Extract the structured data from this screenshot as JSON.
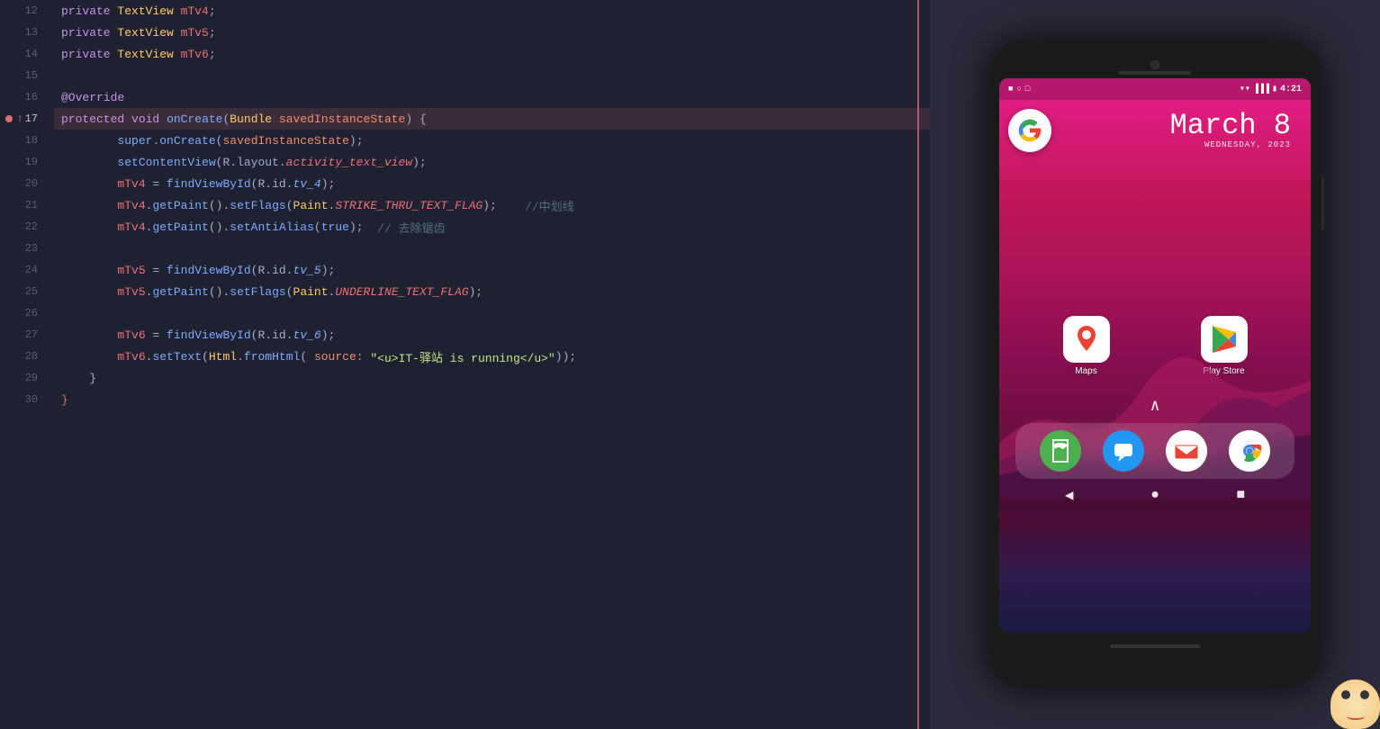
{
  "editor": {
    "lines": [
      {
        "num": 12,
        "content": "    private TextView mTv4;",
        "active": false,
        "breakpoint": false,
        "debugArrow": false
      },
      {
        "num": 13,
        "content": "    private TextView mTv5;",
        "active": false,
        "breakpoint": false,
        "debugArrow": false
      },
      {
        "num": 14,
        "content": "    private TextView mTv6;",
        "active": false,
        "breakpoint": false,
        "debugArrow": false
      },
      {
        "num": 15,
        "content": "",
        "active": false,
        "breakpoint": false,
        "debugArrow": false
      },
      {
        "num": 16,
        "content": "    @Override",
        "active": false,
        "breakpoint": false,
        "debugArrow": false
      },
      {
        "num": 17,
        "content": "    protected void onCreate(Bundle savedInstanceState) {",
        "active": true,
        "breakpoint": true,
        "debugArrow": true
      },
      {
        "num": 18,
        "content": "        super.onCreate(savedInstanceState);",
        "active": false,
        "breakpoint": false,
        "debugArrow": false
      },
      {
        "num": 19,
        "content": "        setContentView(R.layout.activity_text_view);",
        "active": false,
        "breakpoint": false,
        "debugArrow": false
      },
      {
        "num": 20,
        "content": "        mTv4 = findViewById(R.id.tv_4);",
        "active": false,
        "breakpoint": false,
        "debugArrow": false
      },
      {
        "num": 21,
        "content": "        mTv4.getPaint().setFlags(Paint.STRIKE_THRU_TEXT_FLAG);    //中划线",
        "active": false,
        "breakpoint": false,
        "debugArrow": false
      },
      {
        "num": 22,
        "content": "        mTv4.getPaint().setAntiAlias(true);  // 去除锯齿",
        "active": false,
        "breakpoint": false,
        "debugArrow": false
      },
      {
        "num": 23,
        "content": "",
        "active": false,
        "breakpoint": false,
        "debugArrow": false
      },
      {
        "num": 24,
        "content": "        mTv5 = findViewById(R.id.tv_5);",
        "active": false,
        "breakpoint": false,
        "debugArrow": false
      },
      {
        "num": 25,
        "content": "        mTv5.getPaint().setFlags(Paint.UNDERLINE_TEXT_FLAG);",
        "active": false,
        "breakpoint": false,
        "debugArrow": false
      },
      {
        "num": 26,
        "content": "",
        "active": false,
        "breakpoint": false,
        "debugArrow": false
      },
      {
        "num": 27,
        "content": "        mTv6 = findViewById(R.id.tv_6);",
        "active": false,
        "breakpoint": false,
        "debugArrow": false
      },
      {
        "num": 28,
        "content": "        mTv6.setText(Html.fromHtml( source: \"<u>IT-驿站 is running</u>\"));",
        "active": false,
        "breakpoint": false,
        "debugArrow": false
      },
      {
        "num": 29,
        "content": "    }",
        "active": false,
        "breakpoint": false,
        "debugArrow": false
      },
      {
        "num": 30,
        "content": "}",
        "active": false,
        "breakpoint": false,
        "debugArrow": false
      }
    ]
  },
  "phone": {
    "status_bar": {
      "left_icons": [
        "■",
        "○",
        "□"
      ],
      "time": "4:21",
      "right_icons": [
        "WiFi",
        "signal",
        "battery"
      ]
    },
    "date": {
      "day": "March 8",
      "weekday": "WEDNESDAY, 2023"
    },
    "apps": [
      {
        "name": "Maps",
        "icon_type": "maps"
      },
      {
        "name": "Play Store",
        "icon_type": "playstore"
      }
    ],
    "dock": [
      {
        "name": "Phone",
        "icon_type": "phone"
      },
      {
        "name": "Messages",
        "icon_type": "messages"
      },
      {
        "name": "Gmail",
        "icon_type": "gmail"
      },
      {
        "name": "Chrome",
        "icon_type": "chrome"
      }
    ],
    "nav": {
      "back": "◀",
      "home": "●",
      "recent": "■"
    }
  }
}
